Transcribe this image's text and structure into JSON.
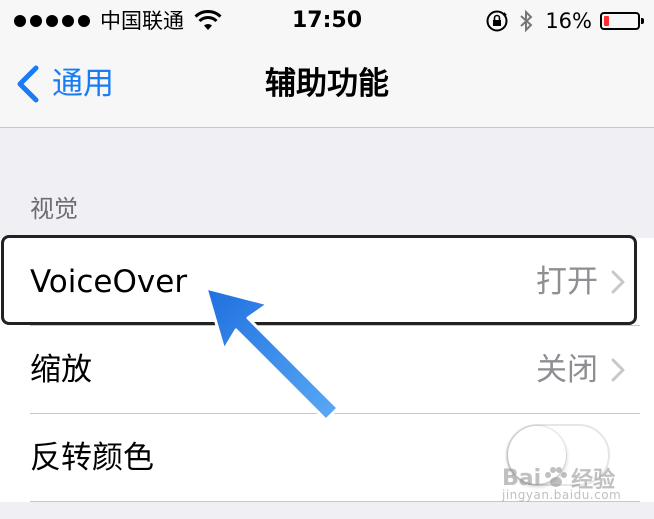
{
  "status_bar": {
    "carrier": "中国联通",
    "time": "17:50",
    "battery_percent": "16%",
    "battery_level": 0.16,
    "battery_color": "#ff2d2d"
  },
  "nav": {
    "back_label": "通用",
    "title": "辅助功能"
  },
  "section": {
    "header": "视觉"
  },
  "rows": [
    {
      "title": "VoiceOver",
      "detail": "打开"
    },
    {
      "title": "缩放",
      "detail": "关闭"
    },
    {
      "title": "反转颜色",
      "toggle_on": false
    }
  ],
  "colors": {
    "accent": "#1a7cf5",
    "annotation_arrow": "#3b8ef0"
  },
  "watermark": {
    "brand_left": "Bai",
    "brand_right": "经验",
    "url": "jingyan.baidu.com"
  }
}
